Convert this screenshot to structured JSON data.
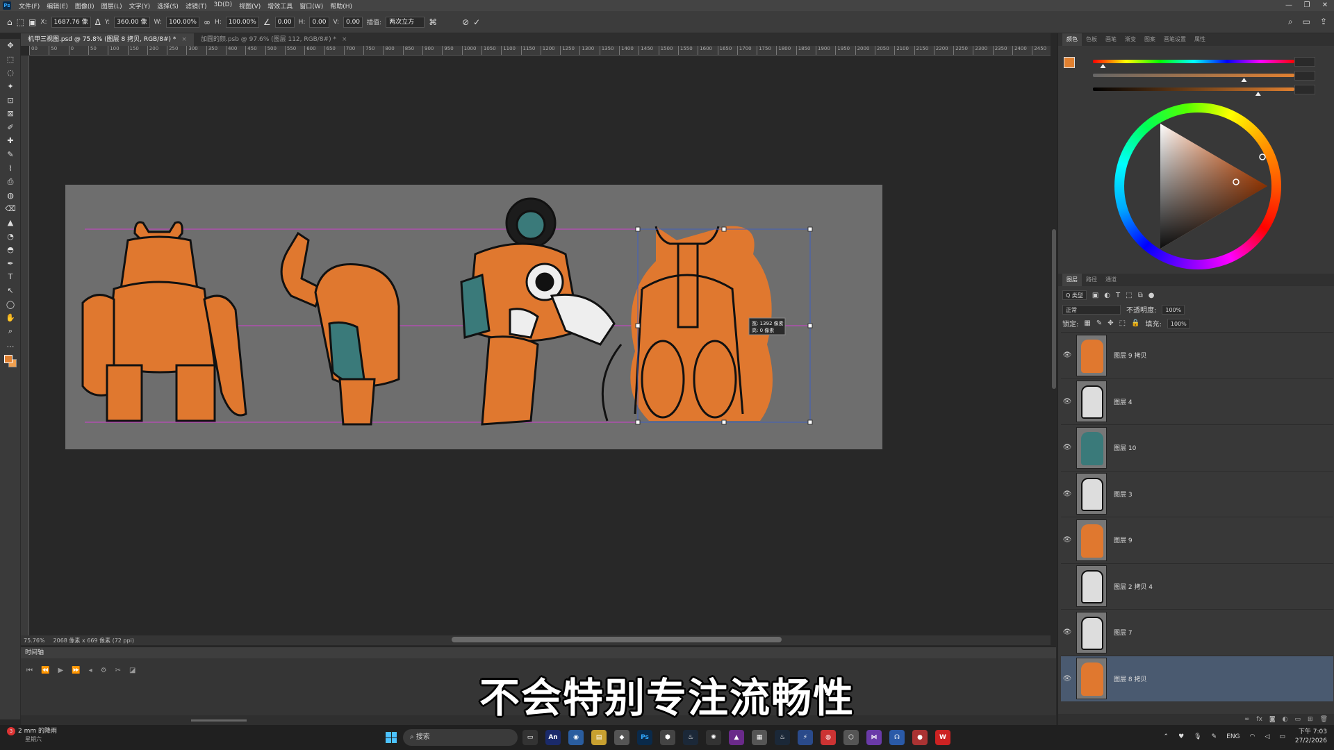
{
  "menubar": {
    "items": [
      "文件(F)",
      "编辑(E)",
      "图像(I)",
      "图层(L)",
      "文字(Y)",
      "选择(S)",
      "滤镜(T)",
      "3D(D)",
      "视图(V)",
      "增效工具",
      "窗口(W)",
      "帮助(H)"
    ]
  },
  "options": {
    "x_label": "X:",
    "x_value": "1687.76 像",
    "y_label": "Y:",
    "y_value": "360.00 像",
    "w_label": "W:",
    "w_value": "100.00%",
    "h_label": "H:",
    "h_value": "100.00%",
    "angle_value": "0.00",
    "hskew_label": "H:",
    "hskew_value": "0.00",
    "vskew_label": "V:",
    "vskew_value": "0.00",
    "interp_label": "插值:",
    "interp_value": "两次立方"
  },
  "tabs": [
    {
      "label": "机甲三视图.psd @ 75.8% (图层 8 拷贝, RGB/8#) *"
    },
    {
      "label": "加圆的颜.psb @ 97.6% (图层 112, RGB/8#) *"
    }
  ],
  "ruler": [
    "00",
    "50",
    "0",
    "50",
    "100",
    "150",
    "200",
    "250",
    "300",
    "350",
    "400",
    "450",
    "500",
    "550",
    "600",
    "650",
    "700",
    "750",
    "800",
    "850",
    "900",
    "950",
    "1000",
    "1050",
    "1100",
    "1150",
    "1200",
    "1250",
    "1300",
    "1350",
    "1400",
    "1450",
    "1500",
    "1550",
    "1600",
    "1650",
    "1700",
    "1750",
    "1800",
    "1850",
    "1900",
    "1950",
    "2000",
    "2050",
    "2100",
    "2150",
    "2200",
    "2250",
    "2300",
    "2350",
    "2400",
    "2450"
  ],
  "transform_tooltip": {
    "line1": "宽: 1392 像素",
    "line2": "高:    0 像素"
  },
  "status": {
    "zoom": "75.76%",
    "size": "2068 像素 x 669 像素 (72 ppi)"
  },
  "timeline": {
    "title": "时间轴"
  },
  "subtitle": "不会特别专注流畅性",
  "color_panel": {
    "tabs": [
      "颜色",
      "色板",
      "画笔",
      "渐变",
      "图案",
      "画笔设置",
      "属性"
    ],
    "slider_values": [
      0.05,
      0.75,
      0.82
    ],
    "wheel_colors": {
      "accent": "#e08030"
    }
  },
  "layers_panel": {
    "tabs": [
      "图层",
      "路径",
      "通道"
    ],
    "filter_label": "Q 类型",
    "blend_mode": "正常",
    "opacity_label": "不透明度:",
    "opacity_value": "100%",
    "lock_label": "锁定:",
    "fill_label": "填充:",
    "fill_value": "100%",
    "layers": [
      {
        "name": "图层 9 拷贝",
        "visible": true,
        "thumb": "orange"
      },
      {
        "name": "图层 4",
        "visible": true,
        "thumb": "lineart-arm"
      },
      {
        "name": "图层 10",
        "visible": true,
        "thumb": "teal"
      },
      {
        "name": "图层 3",
        "visible": true,
        "thumb": "lineart"
      },
      {
        "name": "图层 9",
        "visible": true,
        "thumb": "orange"
      },
      {
        "name": "图层 2 拷贝 4",
        "visible": false,
        "thumb": "lineart"
      },
      {
        "name": "图层 7",
        "visible": true,
        "thumb": "lineart"
      },
      {
        "name": "图层 8 拷贝",
        "visible": true,
        "thumb": "orange",
        "selected": true
      }
    ]
  },
  "taskbar": {
    "weather_title": "2 mm 的降雨",
    "weather_sub": "星期六",
    "weather_badge": "3",
    "search_placeholder": "搜索",
    "lang": "ENG",
    "time": "下午 7:03",
    "date": "27/2/2026"
  }
}
